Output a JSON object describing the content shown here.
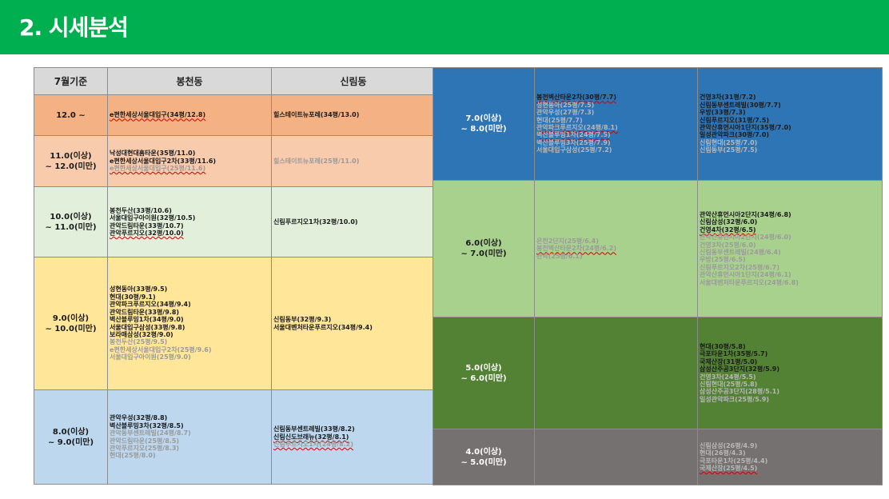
{
  "title": "2. 시세분석",
  "headers": {
    "basis": "7월기준",
    "col1": "봉천동",
    "col2": "신림동"
  },
  "colors": {
    "header_bar": "#00b050"
  },
  "left_rows": [
    {
      "label": [
        "12.0 ~"
      ],
      "bg": "#f4b183",
      "bongcheon": [
        {
          "t": "e편한세상서울대입구(34평/12.8)",
          "c": "b",
          "u": true
        }
      ],
      "sillim": [
        {
          "t": "힐스테이트뉴포레(34평/13.0)",
          "c": "b"
        }
      ]
    },
    {
      "label": [
        "11.0(이상)",
        "~ 12.0(미만)"
      ],
      "bg": "#f8cbad",
      "bongcheon": [
        {
          "t": "낙성대현대홈타운(35평/11.0)",
          "c": "b"
        },
        {
          "t": "e편한세상서울대입구2차(33평/11.6)",
          "c": "b"
        },
        {
          "t": "e편한세상서울대입구(25평/11.6)",
          "c": "g",
          "u": true
        }
      ],
      "sillim": [
        {
          "t": "힐스테이트뉴포레(25평/11.0)",
          "c": "g"
        }
      ]
    },
    {
      "label": [
        "10.0(이상)",
        "~ 11.0(미만)"
      ],
      "bg": "#e2efda",
      "bongcheon": [
        {
          "t": "봉천두산(33평/10.6)",
          "c": "b"
        },
        {
          "t": "서울대입구아이원(32평/10.5)",
          "c": "b"
        },
        {
          "t": "관악드림타운(33평/10.7)",
          "c": "b"
        },
        {
          "t": "관악푸르지오(32평/10.0)",
          "c": "b",
          "u": true
        }
      ],
      "sillim": [
        {
          "t": "신림푸르지오1차(32평/10.0)",
          "c": "b"
        }
      ]
    },
    {
      "label": [
        "9.0(이상)",
        "~ 10.0(미만)"
      ],
      "bg": "#ffe699",
      "bongcheon": [
        {
          "t": "성현동아(33평/9.5)",
          "c": "b"
        },
        {
          "t": "현대(30평/9.1)",
          "c": "b"
        },
        {
          "t": "관악파크푸르지오(34평/9.4)",
          "c": "b"
        },
        {
          "t": "관악드림타운(33평/9.8)",
          "c": "b"
        },
        {
          "t": "벽산블루밍1차(34평/9.0)",
          "c": "b"
        },
        {
          "t": "서울대입구삼성(33평/9.8)",
          "c": "b"
        },
        {
          "t": "보라매삼성(32평/9.0)",
          "c": "b"
        },
        {
          "t": "봉천두산(25평/9.5)",
          "c": "g"
        },
        {
          "t": "e편한세상서울대입구2차(25평/9.6)",
          "c": "g"
        },
        {
          "t": "서울대입구아이원(25평/9.0)",
          "c": "g"
        }
      ],
      "sillim": [
        {
          "t": "신림동부(32평/9.3)",
          "c": "b"
        },
        {
          "t": "서울대벤처타운푸르지오(34평/9.4)",
          "c": "b"
        }
      ]
    },
    {
      "label": [
        "8.0(이상)",
        "~ 9.0(미만)"
      ],
      "bg": "#bdd7ee",
      "bongcheon": [
        {
          "t": "관악우성(32평/8.8)",
          "c": "b"
        },
        {
          "t": "벽산블루밍3차(32평/8.5)",
          "c": "b"
        },
        {
          "t": "관악동부센트레빌(24평/8.7)",
          "c": "g"
        },
        {
          "t": "관악드림타운(25평/8.5)",
          "c": "g"
        },
        {
          "t": "관악푸르지오(25평/8.3)",
          "c": "g"
        },
        {
          "t": "현대(25평/8.0)",
          "c": "g"
        }
      ],
      "sillim": [
        {
          "t": "신림동부센트레빌(33평/8.2)",
          "c": "b"
        },
        {
          "t": "신림신도브래뉴(32평/8.1)",
          "c": "b",
          "u": true
        },
        {
          "t": "신림푸르지오1차(24평/8.2)",
          "c": "g",
          "u": true
        }
      ]
    }
  ],
  "right_rows": [
    {
      "label": [
        "7.0(이상)",
        "~ 8.0(미만)"
      ],
      "bg": "#2e75b6",
      "dark": true,
      "bongcheon": [
        {
          "t": "봉천벽산타운2차(30평/7.7)",
          "c": "b",
          "u": true
        },
        {
          "t": "성현동아(25평/7.5)",
          "c": "wg"
        },
        {
          "t": "관악우성(27평/7.3)",
          "c": "wg"
        },
        {
          "t": "현대(25평/7.7)",
          "c": "wg"
        },
        {
          "t": "관악파크푸르지오(24평/8.1)",
          "c": "wg",
          "u": true
        },
        {
          "t": "벽산블루밍1차(24평/7.5)",
          "c": "wg",
          "u": true
        },
        {
          "t": "벽산블루밍3차(25평/7.9)",
          "c": "wg"
        },
        {
          "t": "서울대입구삼성(25평/7.2)",
          "c": "wg"
        }
      ],
      "sillim": [
        {
          "t": "건영3차(31평/7.2)",
          "c": "b"
        },
        {
          "t": "신림동부센트레빌(30평/7.7)",
          "c": "b"
        },
        {
          "t": "우방(33평/7.3)",
          "c": "b"
        },
        {
          "t": "신림푸르지오(31평/7.5)",
          "c": "b"
        },
        {
          "t": "관악산휴먼시아1단지(35평/7.0)",
          "c": "b"
        },
        {
          "t": "일성관악파크(30평/7.0)",
          "c": "b"
        },
        {
          "t": "신림현대(25평/7.0)",
          "c": "wg"
        },
        {
          "t": "신림동부(25평/7.5)",
          "c": "wg"
        }
      ]
    },
    {
      "label": [
        "6.0(이상)",
        "~ 7.0(미만)"
      ],
      "bg": "#a9d18e",
      "bongcheon": [
        {
          "t": "은천2단지(25평/6.4)",
          "c": "g"
        },
        {
          "t": "봉천벽산타운2차(24평/6.2)",
          "c": "g",
          "u": true
        },
        {
          "t": "관악(25평/6.1)",
          "c": "g"
        }
      ],
      "sillim": [
        {
          "t": "관악산휴먼시아2단지(34평/6.8)",
          "c": "b"
        },
        {
          "t": "신림삼성(32평/6.0)",
          "c": "b"
        },
        {
          "t": "건영4차(32평/6.5)",
          "c": "b",
          "u": true
        },
        {
          "t": "관악산휴먼시아2단지(24평/6.0)",
          "c": "g"
        },
        {
          "t": "건영3차(25평/6.0)",
          "c": "g"
        },
        {
          "t": "신림동부센트레빌(24평/6.4)",
          "c": "g"
        },
        {
          "t": "우방(25평/6.5)",
          "c": "g"
        },
        {
          "t": "신림푸르지오2차(25평/6.7)",
          "c": "g"
        },
        {
          "t": "관악산휴먼시아1단지(24평/6.1)",
          "c": "g"
        },
        {
          "t": "서울대벤처타운푸르지오(24평/6.8)",
          "c": "g"
        }
      ]
    },
    {
      "label": [
        "5.0(이상)",
        "~ 6.0(미만)"
      ],
      "bg": "#548235",
      "dark": true,
      "bongcheon": [],
      "sillim": [
        {
          "t": "현대(30평/5.8)",
          "c": "b"
        },
        {
          "t": "극포타운1차(35평/5.7)",
          "c": "b"
        },
        {
          "t": "국제산장(31평/5.0)",
          "c": "b"
        },
        {
          "t": "삼성산주공3단지(32평/5.9)",
          "c": "b"
        },
        {
          "t": "건영3차(24평/5.5)",
          "c": "wg"
        },
        {
          "t": "신림현대(25평/5.8)",
          "c": "wg"
        },
        {
          "t": "삼성산주공3단지(28평/5.1)",
          "c": "wg"
        },
        {
          "t": "일성관악파크(25평/5.9)",
          "c": "wg"
        }
      ]
    },
    {
      "label": [
        "4.0(이상)",
        "~ 5.0(미만)"
      ],
      "bg": "#767171",
      "dark": true,
      "bongcheon": [],
      "sillim": [
        {
          "t": "신림삼성(26평/4.9)",
          "c": "wg"
        },
        {
          "t": "현대(26평/4.3)",
          "c": "wg"
        },
        {
          "t": "극포타운1차(25평/4.4)",
          "c": "wg"
        },
        {
          "t": "국제산장(25평/4.5)",
          "c": "wg",
          "u": true
        }
      ]
    }
  ]
}
